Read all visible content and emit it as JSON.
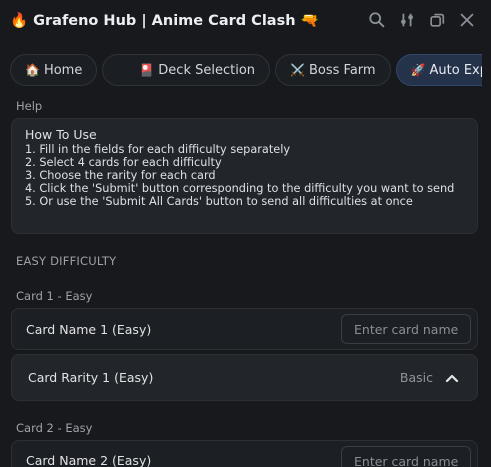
{
  "window": {
    "title_icon": "🔥",
    "title": "Grafeno Hub | Anime Card Clash",
    "title_emoji": "🔫"
  },
  "tabs": [
    {
      "icon": "🏠",
      "label": "Home",
      "active": false
    },
    {
      "icon": "🎴",
      "label": "Deck Selection",
      "active": false
    },
    {
      "icon": "⚔️",
      "label": "Boss Farm",
      "active": false
    },
    {
      "icon": "🚀",
      "label": "Auto Expl",
      "active": true
    }
  ],
  "help": {
    "section_label": "Help",
    "heading": "How To Use",
    "lines": [
      "1. Fill in the fields for each difficulty separately",
      "2. Select 4 cards for each difficulty",
      "3. Choose the rarity for each card",
      "4. Click the 'Submit' button corresponding to the difficulty you want to send",
      "5. Or use the 'Submit All Cards' button to send all difficulties at once"
    ]
  },
  "easy": {
    "section_label": "EASY DIFFICULTY",
    "card1": {
      "header": "Card 1 - Easy",
      "name_label": "Card Name 1 (Easy)",
      "name_placeholder": "Enter card name",
      "rarity_label": "Card Rarity 1 (Easy)",
      "rarity_value": "Basic"
    },
    "card2": {
      "header": "Card 2 - Easy",
      "name_label": "Card Name 2 (Easy)",
      "name_placeholder": "Enter card name"
    }
  }
}
